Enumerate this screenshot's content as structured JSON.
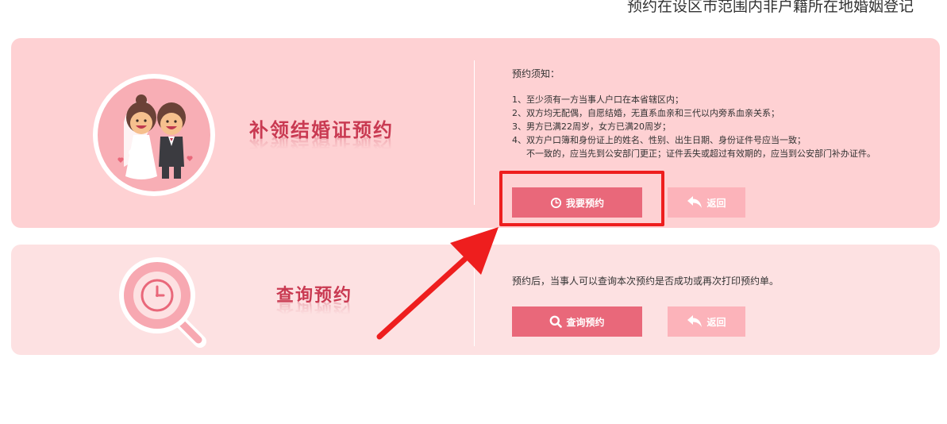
{
  "top_notice": "预约在设区市范围内非户籍所在地婚姻登记",
  "cards": [
    {
      "title": "补领结婚证预约",
      "illustration_icon": "bride-groom-icon",
      "notice_heading": "预约须知：",
      "notice_lines": [
        "1、至少须有一方当事人户口在本省辖区内；",
        "2、双方均无配偶，自愿结婚，无直系血亲和三代以内旁系血亲关系；",
        "3、男方已满22周岁，女方已满20周岁；",
        "4、双方户口簿和身份证上的姓名、性别、出生日期、身份证件号应当一致；",
        "不一致的，应当先到公安部门更正；证件丢失或超过有效期的，应当到公安部门补办证件。"
      ],
      "primary_button": {
        "label": "我要预约",
        "icon": "clock-icon"
      },
      "back_button": {
        "label": "返回",
        "icon": "return-arrow-icon"
      }
    },
    {
      "title": "查询预约",
      "illustration_icon": "magnifier-clock-icon",
      "notice_text": "预约后，当事人可以查询本次预约是否成功或再次打印预约单。",
      "primary_button": {
        "label": "查询预约",
        "icon": "search-icon"
      },
      "back_button": {
        "label": "返回",
        "icon": "return-arrow-icon"
      }
    }
  ],
  "colors": {
    "card1_bg": "#fed1d3",
    "card2_bg": "#fde1e2",
    "primary_button": "#e9687a",
    "back_button": "#fcb3ba",
    "title": "#c93a52",
    "annotation_red": "#ee1e1e"
  }
}
